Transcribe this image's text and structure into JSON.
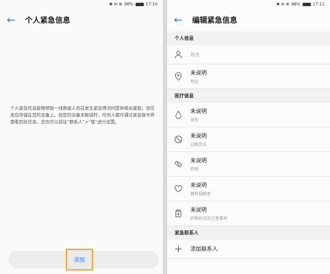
{
  "left": {
    "status": {
      "icons": "✱ ✉ ≣",
      "battery": "98%",
      "time": "17:10"
    },
    "title": "个人紧急信息",
    "intro_text": "个人紧急信息能够帮助一线救援人员在发生紧急情况时提供相关援助。该信息仅存储在您的设备上。但您的设备未解锁时，任何人都可通过紧急拨号界面看到此信息。您也可以前往“联系人”>“我”进行设置。",
    "add_label": "添加"
  },
  "right": {
    "status": {
      "icons": "✱ ✉ ≣",
      "battery": "98%",
      "time": "17:11"
    },
    "title": "编辑紧急信息",
    "sections": {
      "personal": "个人信息",
      "medical": "医疗信息",
      "contacts": "紧急联系人"
    },
    "name_placeholder": "姓名",
    "address": {
      "value": "未说明",
      "label": "地址"
    },
    "blood": {
      "value": "未说明",
      "label": "血型"
    },
    "allergy": {
      "value": "未说明",
      "label": "过敏反应"
    },
    "medication": {
      "value": "未说明",
      "label": "药物"
    },
    "organ": {
      "value": "未说明",
      "label": "器官捐献者"
    },
    "medical_notes": {
      "value": "未说明",
      "label": "药物状况及注意事项"
    },
    "add_contact": "添加联系人"
  },
  "colors": {
    "accent": "#2b7ce9",
    "highlight": "#f2a93b"
  }
}
